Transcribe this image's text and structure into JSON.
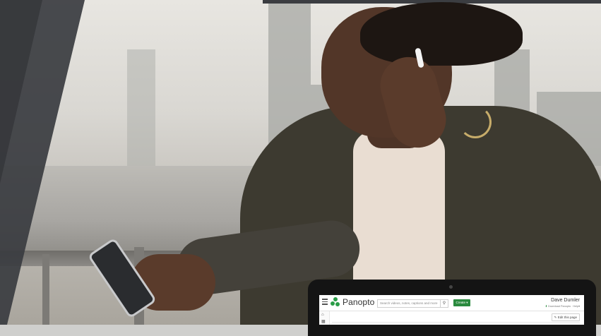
{
  "hero": {
    "photo_desc_icon": "person-with-phone-photo"
  },
  "panopto": {
    "logo_text": "Panopto",
    "search_placeholder": "Search videos, notes, captions and more",
    "search_icon": "search-icon",
    "create_label": "Create",
    "user_name": "Dave Dumler",
    "download_label": "Download Panopto",
    "help_label": "Help",
    "edit_label": "Edit this page"
  },
  "colors": {
    "brand_green": "#2a8a3e",
    "logo_green": "#2a9c47",
    "dark_wedge": "#3a3c40"
  }
}
